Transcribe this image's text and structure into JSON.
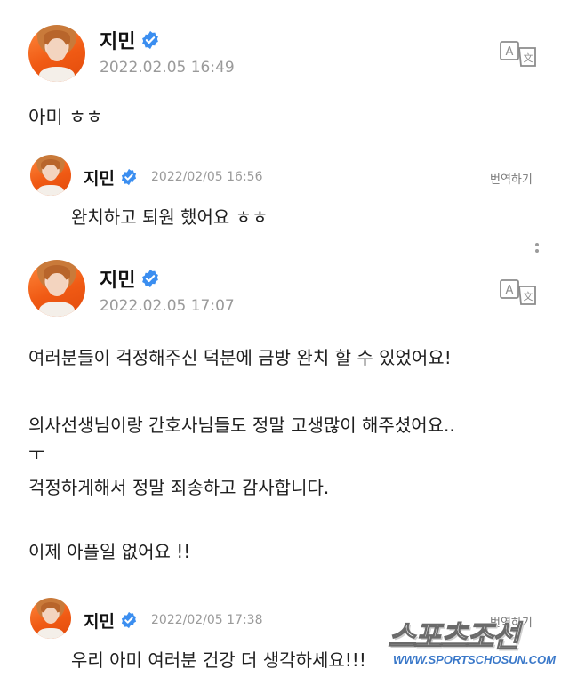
{
  "posts": [
    {
      "author": "지민",
      "timestamp": "2022.02.05 16:49",
      "body": [
        "아미 ㅎㅎ"
      ]
    },
    {
      "author": "지민",
      "timestamp": "2022.02.05 17:07",
      "body": [
        "여러분들이 걱정해주신 덕분에 금방 완치 할 수 있었어요!",
        "의사선생님이랑 간호사님들도 정말 고생많이 해주셨어요..",
        "ㅜ",
        "걱정하게해서 정말 죄송하고 감사합니다.",
        "이제 아플일 없어요 !!"
      ]
    }
  ],
  "replies": [
    {
      "author": "지민",
      "timestamp": "2022/02/05 16:56",
      "translate_label": "번역하기",
      "body": "완치하고 퇴원 했어요 ㅎㅎ"
    },
    {
      "author": "지민",
      "timestamp": "2022/02/05 17:38",
      "translate_label": "번역하기",
      "body": "우리 아미 여러분 건강 더 생각하세요!!!"
    }
  ],
  "watermark": {
    "brand": "스포츠조선",
    "url": "WWW.SPORTSCHOSUN.COM"
  },
  "colors": {
    "verified_badge": "#3b8ef0",
    "avatar_bg": "#f26a1b",
    "timestamp": "#9a9a9a",
    "watermark_url": "#3a78c9"
  },
  "icons": [
    "verified-badge-icon",
    "translate-icon",
    "more-options-icon"
  ]
}
